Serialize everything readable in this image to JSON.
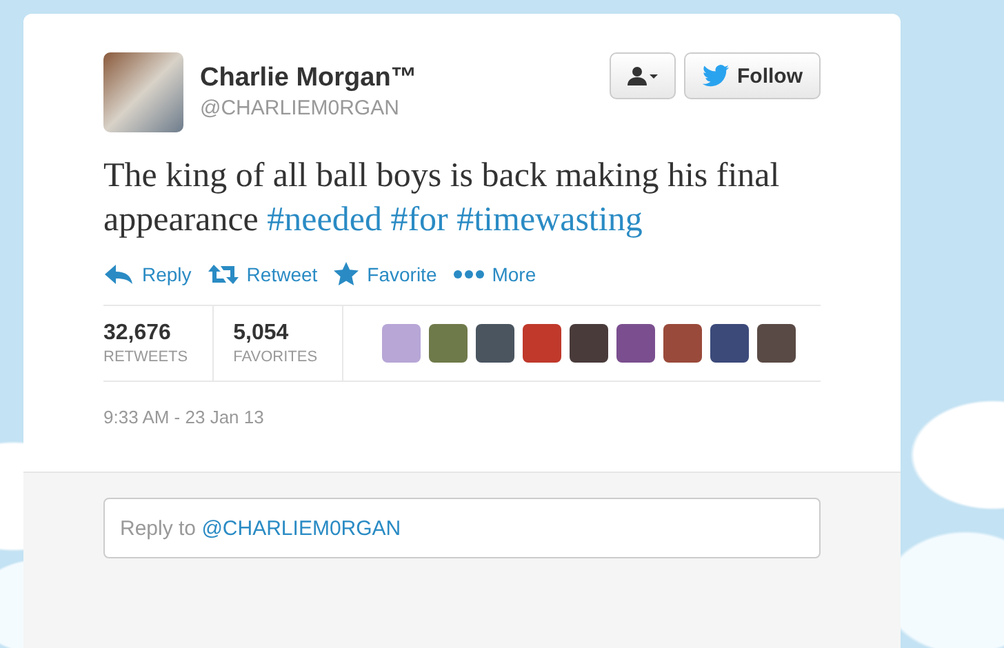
{
  "author": {
    "name": "Charlie Morgan™",
    "handle": "@CHARLIEM0RGAN"
  },
  "buttons": [
    {
      "kind": "user-menu"
    },
    {
      "kind": "follow",
      "label": "Follow"
    }
  ],
  "tweet": {
    "segments": [
      {
        "kind": "text",
        "text": "The king of all ball boys is back making his final appearance "
      },
      {
        "kind": "hashtag",
        "text": "#needed"
      },
      {
        "kind": "hashtag",
        "text": "#for"
      },
      {
        "kind": "hashtag",
        "text": "#timewasting"
      }
    ]
  },
  "actions": [
    {
      "kind": "reply",
      "label": "Reply"
    },
    {
      "kind": "retweet",
      "label": "Retweet"
    },
    {
      "kind": "favorite",
      "label": "Favorite"
    },
    {
      "kind": "more",
      "label": "More"
    }
  ],
  "stats": [
    {
      "count": "32,676",
      "label": "RETWEETS"
    },
    {
      "count": "5,054",
      "label": "FAVORITES"
    }
  ],
  "favoriters": [
    {
      "color": "#b7a6d6"
    },
    {
      "color": "#6f7a4a"
    },
    {
      "color": "#4a5560"
    },
    {
      "color": "#c0392b"
    },
    {
      "color": "#4a3b3b"
    },
    {
      "color": "#7b4f8f"
    },
    {
      "color": "#9a4a3a"
    },
    {
      "color": "#3c4a7a"
    },
    {
      "color": "#5a4a45"
    }
  ],
  "timestamp": "9:33 AM - 23 Jan 13",
  "reply_box": {
    "placeholder": "Reply to",
    "mention": "@CHARLIEM0RGAN"
  }
}
